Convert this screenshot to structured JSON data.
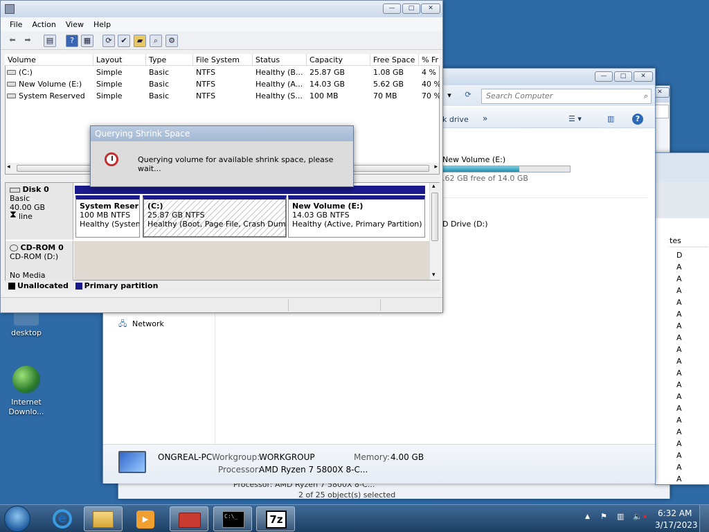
{
  "desktop": {
    "icons": [
      {
        "label": "desktop"
      },
      {
        "label_line1": "Internet",
        "label_line2": "Downlo..."
      }
    ]
  },
  "explorer_back": {
    "search_placeholder": "Search Computer",
    "hidden_processor_text": "Processor: AMD Ryzen 7 5800X 8-C...",
    "hidden_status": "2 of 25 object(s) selected"
  },
  "explorer": {
    "search_placeholder": "Search Computer",
    "toolbar_item": "k drive",
    "more": "»",
    "drive": {
      "name": "New Volume (E:)",
      "free_text": ".62 GB free of 14.0 GB",
      "used_fraction": 0.6
    },
    "cd_drive": "D Drive (D:)",
    "sidebar_network": "Network",
    "details": {
      "computer_name": "ONGREAL-PC",
      "workgroup_label": "Workgroup:",
      "workgroup_value": "WORKGROUP",
      "memory_label": "Memory:",
      "memory_value": "4.00 GB",
      "processor_label": "Processor:",
      "processor_value": "AMD Ryzen 7 5800X 8-C..."
    }
  },
  "right_panel": {
    "header": "tes",
    "rows": [
      "D",
      "A",
      "A",
      "A",
      "A",
      "A",
      "A",
      "A",
      "A",
      "A",
      "A",
      "A",
      "A",
      "A",
      "A",
      "A",
      "A",
      "A",
      "A",
      "A"
    ]
  },
  "disk_mgmt": {
    "menu": [
      "File",
      "Action",
      "View",
      "Help"
    ],
    "columns": [
      "Volume",
      "Layout",
      "Type",
      "File System",
      "Status",
      "Capacity",
      "Free Space",
      "% Fr"
    ],
    "volumes": [
      {
        "volume": "(C:)",
        "layout": "Simple",
        "type": "Basic",
        "fs": "NTFS",
        "status": "Healthy (B...",
        "capacity": "25.87 GB",
        "free": "1.08 GB",
        "pct": "4 %"
      },
      {
        "volume": "New Volume (E:)",
        "layout": "Simple",
        "type": "Basic",
        "fs": "NTFS",
        "status": "Healthy (A...",
        "capacity": "14.03 GB",
        "free": "5.62 GB",
        "pct": "40 %"
      },
      {
        "volume": "System Reserved",
        "layout": "Simple",
        "type": "Basic",
        "fs": "NTFS",
        "status": "Healthy (S...",
        "capacity": "100 MB",
        "free": "70 MB",
        "pct": "70 %"
      }
    ],
    "disk0": {
      "name": "Disk 0",
      "type": "Basic",
      "size": "40.00 GB",
      "status": "line",
      "partitions": [
        {
          "title": "System Reser",
          "size": "100 MB NTFS",
          "health": "Healthy (System,"
        },
        {
          "title": "(C:)",
          "size": "25.87 GB NTFS",
          "health": "Healthy (Boot, Page File, Crash Dump, Pr"
        },
        {
          "title": "New Volume  (E:)",
          "size": "14.03 GB NTFS",
          "health": "Healthy (Active, Primary Partition)"
        }
      ]
    },
    "cdrom": {
      "name": "CD-ROM 0",
      "drive": "CD-ROM (D:)",
      "media": "No Media"
    },
    "legend": {
      "unallocated": "Unallocated",
      "primary": "Primary partition"
    },
    "colors": {
      "primary": "#1a1a8c",
      "unallocated": "#000000"
    }
  },
  "dialog": {
    "title": "Querying Shrink Space",
    "message": "Querying volume for available shrink space, please wait..."
  },
  "taskbar": {
    "time": "6:32 AM",
    "date": "3/17/2023",
    "seven_zip_label": "7z",
    "cmd_label": "C:\\_"
  },
  "icons": {
    "window_controls": [
      "minimize-icon",
      "maximize-icon",
      "close-icon"
    ],
    "tray": [
      "show-hidden-icon",
      "flag-icon",
      "network-icon",
      "volume-muted-icon"
    ]
  }
}
